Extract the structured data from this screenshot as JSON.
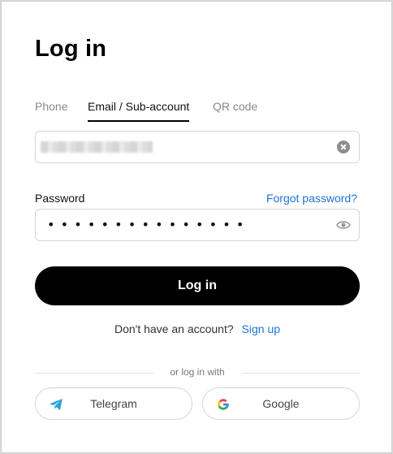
{
  "login": {
    "title": "Log in",
    "tabs": [
      {
        "label": "Phone",
        "active": false
      },
      {
        "label": "Email / Sub-account",
        "active": true
      },
      {
        "label": "QR code",
        "active": false
      }
    ],
    "email_field": {
      "value": "",
      "clear_icon": "clear-circle-x-icon"
    },
    "password": {
      "label": "Password",
      "forgot_label": "Forgot password?",
      "masked_value": "•••••••••••••••",
      "visibility_icon": "eye-icon"
    },
    "submit_label": "Log in",
    "signup": {
      "text": "Don't have an account?",
      "link_label": "Sign up"
    },
    "divider_text": "or log in with",
    "social": [
      {
        "label": "Telegram",
        "icon": "telegram-icon"
      },
      {
        "label": "Google",
        "icon": "google-icon"
      }
    ]
  },
  "colors": {
    "primary_button": "#000000",
    "link": "#1f72d9",
    "telegram": "#2aa3df",
    "border": "#d6d6d6"
  }
}
